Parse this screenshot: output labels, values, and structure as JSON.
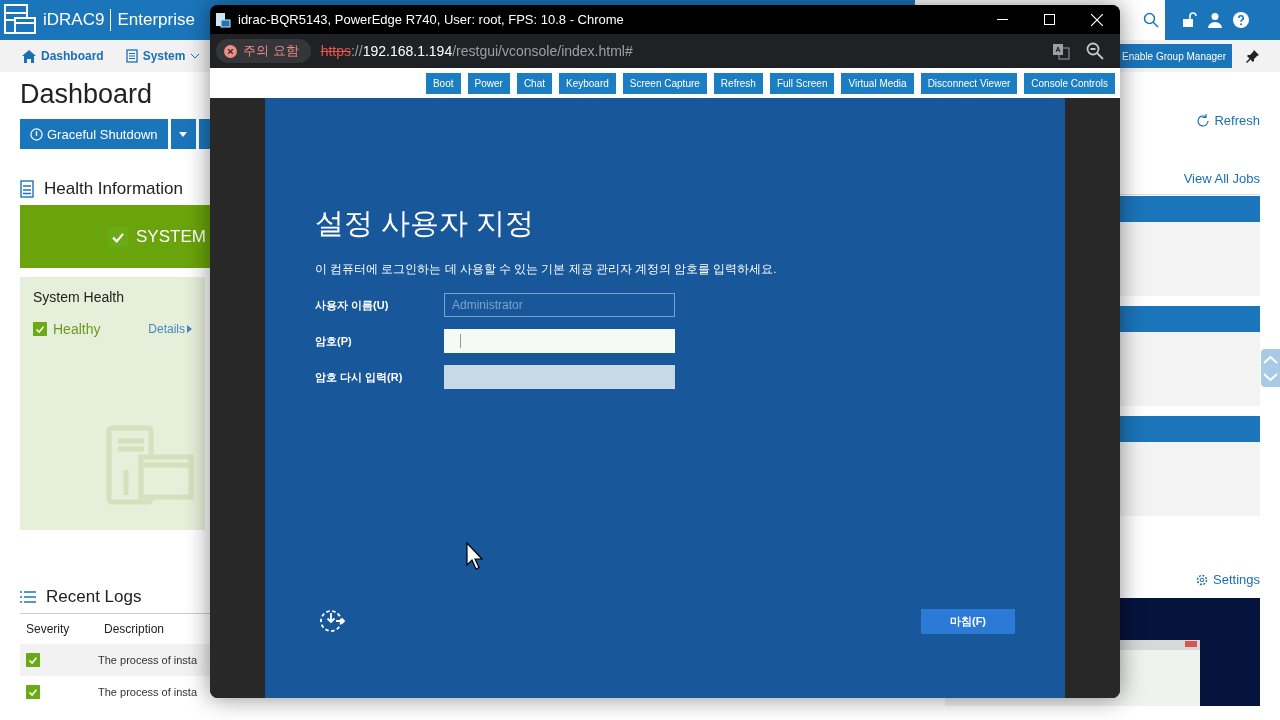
{
  "app": {
    "name": "iDRAC9",
    "edition": "Enterprise"
  },
  "nav": {
    "items": [
      "Dashboard",
      "System"
    ],
    "group_manager_button": "Enable Group Manager"
  },
  "page": {
    "title": "Dashboard",
    "shutdown_button": "Graceful Shutdown",
    "refresh_link": "Refresh",
    "health": {
      "heading": "Health Information",
      "banner": "SYSTEM",
      "card_title": "System Health",
      "status": "Healthy",
      "details_link": "Details"
    },
    "jobs_link": "View All Jobs",
    "logs": {
      "heading": "Recent Logs",
      "columns": [
        "Severity",
        "Description"
      ],
      "rows": [
        {
          "description": "The process of insta"
        },
        {
          "description": "The process of insta"
        }
      ]
    },
    "settings_link": "Settings"
  },
  "browser": {
    "title": "idrac-BQR5143, PowerEdge R740, User: root, FPS: 10.8 - Chrome",
    "security_chip": "주의 요함",
    "url": {
      "scheme": "https",
      "separator": "://",
      "host": "192.168.1.194",
      "path": "/restgui/vconsole/index.html#"
    },
    "toolbar": [
      "Boot",
      "Power",
      "Chat",
      "Keyboard",
      "Screen Capture",
      "Refresh",
      "Full Screen",
      "Virtual Media",
      "Disconnect Viewer",
      "Console Controls"
    ],
    "screen": {
      "title": "설정 사용자 지정",
      "instructions": "이 컴퓨터에 로그인하는 데 사용할 수 있는 기본 제공 관리자 계정의 암호를 입력하세요.",
      "fields": [
        {
          "label": "사용자 이름(U)",
          "placeholder": "Administrator",
          "focused": false,
          "disabled": false
        },
        {
          "label": "암호(P)",
          "focused": true,
          "disabled": false
        },
        {
          "label": "암호 다시 입력(R)",
          "focused": false,
          "disabled": true
        }
      ],
      "finish_button": "마침(F)"
    }
  }
}
